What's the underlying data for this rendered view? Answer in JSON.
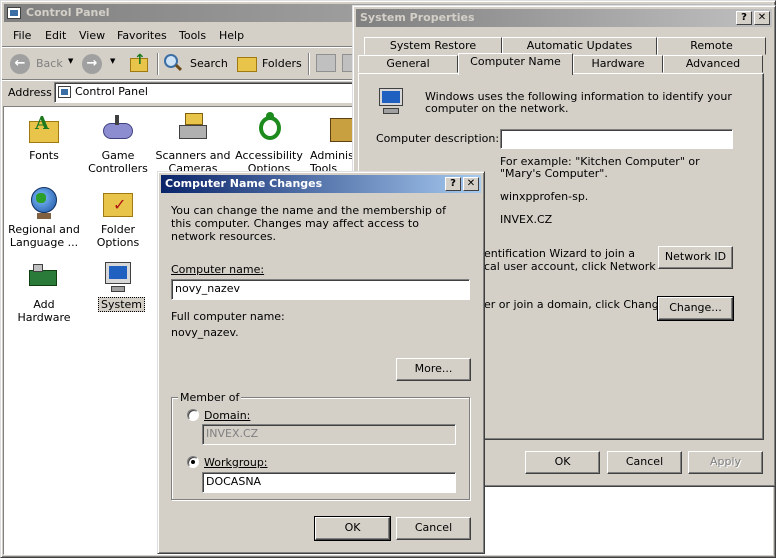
{
  "control_panel": {
    "title": "Control Panel",
    "menu": [
      "File",
      "Edit",
      "View",
      "Favorites",
      "Tools",
      "Help"
    ],
    "toolbar": {
      "back": "Back",
      "search": "Search",
      "folders": "Folders"
    },
    "address_label": "Address",
    "address_value": "Control Panel",
    "icons": [
      {
        "label": "Fonts",
        "icon": "fonts-folder-icon"
      },
      {
        "label": "Game Controllers",
        "icon": "game-controller-icon"
      },
      {
        "label": "Scanners and Cameras",
        "icon": "scanner-camera-icon"
      },
      {
        "label": "Accessibility Options",
        "icon": "accessibility-icon"
      },
      {
        "label": "Administrative Tools",
        "icon": "admin-tools-icon"
      },
      {
        "label": "Regional and Language ...",
        "icon": "globe-icon"
      },
      {
        "label": "Folder Options",
        "icon": "folder-options-icon"
      },
      {
        "label": "Add Hardware",
        "icon": "add-hardware-icon"
      },
      {
        "label": "System",
        "icon": "system-icon"
      }
    ]
  },
  "system_properties": {
    "title": "System Properties",
    "tabs_row1": [
      "System Restore",
      "Automatic Updates",
      "Remote"
    ],
    "tabs_row2": [
      "General",
      "Computer Name",
      "Hardware",
      "Advanced"
    ],
    "intro": "Windows uses the following information to identify your computer on the network.",
    "description_label": "Computer description:",
    "description_value": "",
    "example": "For example: \"Kitchen Computer\" or \"Mary's Computer\".",
    "full_name_value": "winxpprofen-sp.",
    "domain_value": "INVEX.CZ",
    "network_id_text1": "entification Wizard to join a",
    "network_id_text2": "cal user account, click Network",
    "network_id_button": "Network ID",
    "change_text": "er or join a domain, click Change.",
    "change_button": "Change...",
    "ok": "OK",
    "cancel": "Cancel",
    "apply": "Apply"
  },
  "name_changes": {
    "title": "Computer Name Changes",
    "intro": "You can change the name and the membership of this computer. Changes may affect access to network resources.",
    "computer_name_label": "Computer name:",
    "computer_name_value": "novy_nazev",
    "full_name_label": "Full computer name:",
    "full_name_value": "novy_nazev.",
    "more_button": "More...",
    "member_of": "Member of",
    "domain_label": "Domain:",
    "domain_value": "INVEX.CZ",
    "workgroup_label": "Workgroup:",
    "workgroup_value": "DOCASNA",
    "selected": "workgroup",
    "ok": "OK",
    "cancel": "Cancel"
  },
  "colors": {
    "active_title": "#0a246a",
    "inactive_title": "#808080",
    "face": "#d4d0c8"
  }
}
